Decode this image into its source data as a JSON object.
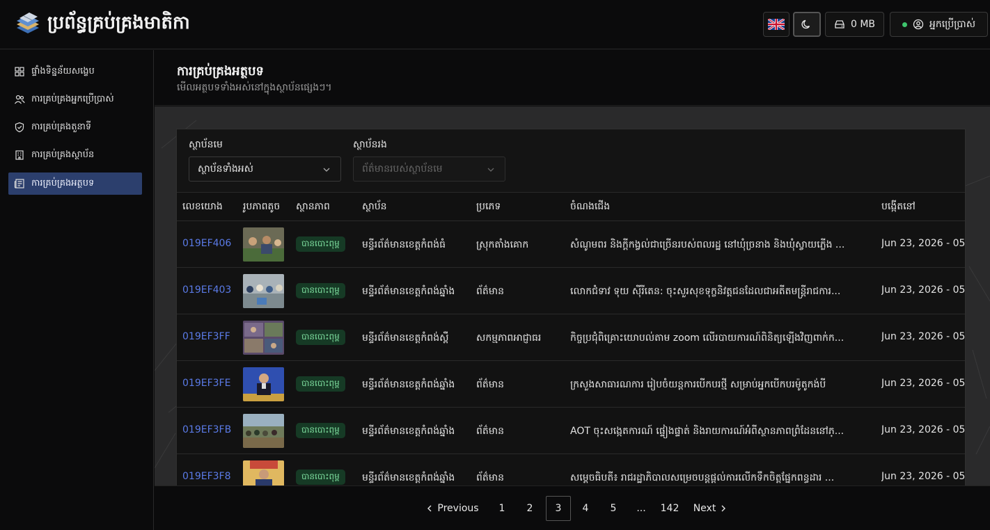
{
  "app": {
    "title": "ប្រព័ន្ធគ្រប់គ្រងមាតិកា"
  },
  "header": {
    "language_icon": "uk-flag-icon",
    "theme_icon": "moon-icon",
    "storage_label": "0 MB",
    "user_label": "អ្នកប្រើប្រាស់",
    "status_color": "#3ec46d"
  },
  "sidebar": {
    "items": [
      {
        "label": "ផ្ទាំងទិន្នន័យសង្ខេប",
        "icon": "dashboard-icon",
        "active": false
      },
      {
        "label": "ការគ្រប់គ្រងអ្នកប្រើប្រាស់",
        "icon": "users-icon",
        "active": false
      },
      {
        "label": "ការគ្រប់គ្រងតួនាទី",
        "icon": "shield-icon",
        "active": false
      },
      {
        "label": "ការគ្រប់គ្រងស្ថាប័ន",
        "icon": "building-icon",
        "active": false
      },
      {
        "label": "ការគ្រប់គ្រងអត្ថបទ",
        "icon": "newspaper-icon",
        "active": true
      }
    ]
  },
  "page": {
    "title": "ការគ្រប់គ្រងអត្ថបទ",
    "subtitle": "មើលអត្ថបទទាំងអស់នៅក្នុងស្ថាប័នផ្សេងៗ។"
  },
  "filters": {
    "parent_label": "ស្ថាប័នមេ",
    "parent_value": "ស្ថាប័នទាំងអស់",
    "child_label": "ស្ថាប័នរង",
    "child_placeholder": "ព័ត៌មានរបស់ស្ថាប័នមេ"
  },
  "table": {
    "columns": [
      "លេខយោង",
      "រូបភាពតូច",
      "ស្ថានភាព",
      "ស្ថាប័ន",
      "ប្រភេទ",
      "ចំណងជើង",
      "បង្កើតនៅ"
    ],
    "rows": [
      {
        "ref": "019EF406",
        "status": "បានបោះពុម្ព",
        "org": "មន្ទីរព័ត៌មានខេត្តកំពង់ធំ",
        "type": "ស្រុកតាំងគោក",
        "title": "សំណូមពរ និងក្តីកង្វល់ជាច្រើនរបស់ពលរដ្ឋ នៅឃុំច្រនាង និងឃុំស្វាយភ្លើង ...",
        "created": "Jun 23, 2026 - 05:"
      },
      {
        "ref": "019EF403",
        "status": "បានបោះពុម្ព",
        "org": "មន្ទីរព័ត៌មានខេត្តកំពង់ឆ្នាំង",
        "type": "ព័ត៌មាន",
        "title": "លោកជំទាវ ទុយ ស៊ីរីតេន: ចុះសួរសុខទុក្ខនិវត្តជនដែលជាអតីតមន្ត្រីរាជការ...",
        "created": "Jun 23, 2026 - 05:"
      },
      {
        "ref": "019EF3FF",
        "status": "បានបោះពុម្ព",
        "org": "មន្ទីរព័ត៌មានខេត្តកំពង់ស្ពឺ",
        "type": "សកម្មភាពអាជ្ញាធរ",
        "title": "កិច្ចប្រជុំពិគ្រោះយោបល់តាម zoom លើរបាយការណ៍ពិនិត្យឡើងវិញពាក់ក...",
        "created": "Jun 23, 2026 - 05:"
      },
      {
        "ref": "019EF3FE",
        "status": "បានបោះពុម្ព",
        "org": "មន្ទីរព័ត៌មានខេត្តកំពង់ឆ្នាំង",
        "type": "ព័ត៌មាន",
        "title": "ក្រសួងសាធារណការ រៀបចំយន្តការបើកបរថ្មី សម្រាប់អ្នកបើកបរម៉ូតូកង់បី",
        "created": "Jun 23, 2026 - 05:"
      },
      {
        "ref": "019EF3FB",
        "status": "បានបោះពុម្ព",
        "org": "មន្ទីរព័ត៌មានខេត្តកំពង់ឆ្នាំង",
        "type": "ព័ត៌មាន",
        "title": "AOT ចុះសង្កេតការណ៍ ផ្ទៀងផ្ទាត់ និងរាយការណ៍អំពីស្ថានភាពព្រំដែននៅភ្...",
        "created": "Jun 23, 2026 - 05:"
      },
      {
        "ref": "019EF3F8",
        "status": "បានបោះពុម្ព",
        "org": "មន្ទីរព័ត៌មានខេត្តកំពង់ឆ្នាំង",
        "type": "ព័ត៌មាន",
        "title": "សម្តេចធិបតី៖ រាជរដ្ឋាភិបាលសម្រេចបន្តផ្តល់ការលើកទឹកចិត្តផ្នែកពន្ធដារ ...",
        "created": "Jun 23, 2026 - 05:"
      }
    ]
  },
  "pagination": {
    "previous": "Previous",
    "pages": [
      "1",
      "2",
      "3",
      "4",
      "5",
      "...",
      "142"
    ],
    "current": "3",
    "next": "Next"
  }
}
